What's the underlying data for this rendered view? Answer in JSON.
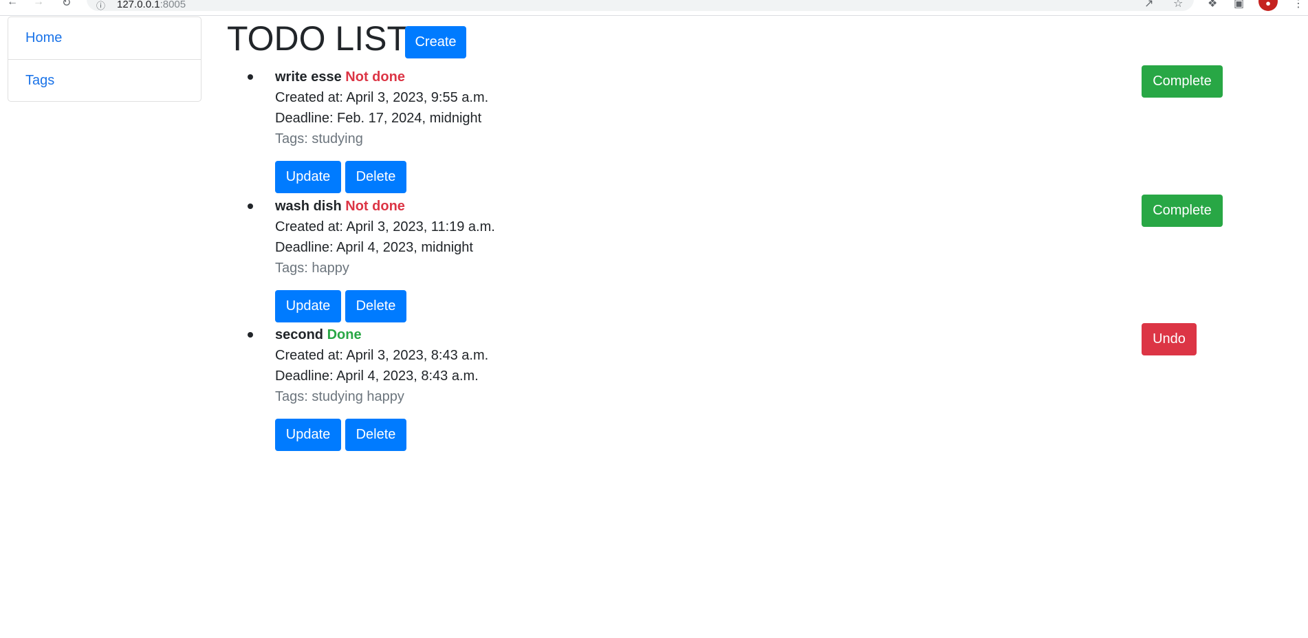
{
  "browser": {
    "url_host": "127.0.0.1",
    "url_port": ":8005"
  },
  "sidebar": {
    "items": [
      {
        "label": "Home"
      },
      {
        "label": "Tags"
      }
    ]
  },
  "header": {
    "title": "TODO LIST",
    "create_label": "Create"
  },
  "todos": [
    {
      "name": "write esse",
      "status": "Not done",
      "created": "Created at: April 3, 2023, 9:55 a.m.",
      "deadline": "Deadline: Feb. 17, 2024, midnight",
      "tags": "Tags: studying",
      "update_label": "Update",
      "delete_label": "Delete",
      "toggle_label": "Complete"
    },
    {
      "name": "wash dish",
      "status": "Not done",
      "created": "Created at: April 3, 2023, 11:19 a.m.",
      "deadline": "Deadline: April 4, 2023, midnight",
      "tags": "Tags: happy",
      "update_label": "Update",
      "delete_label": "Delete",
      "toggle_label": "Complete"
    },
    {
      "name": "second",
      "status": "Done",
      "created": "Created at: April 3, 2023, 8:43 a.m.",
      "deadline": "Deadline: April 4, 2023, 8:43 a.m.",
      "tags": "Tags: studying happy",
      "update_label": "Update",
      "delete_label": "Delete",
      "toggle_label": "Undo"
    }
  ]
}
